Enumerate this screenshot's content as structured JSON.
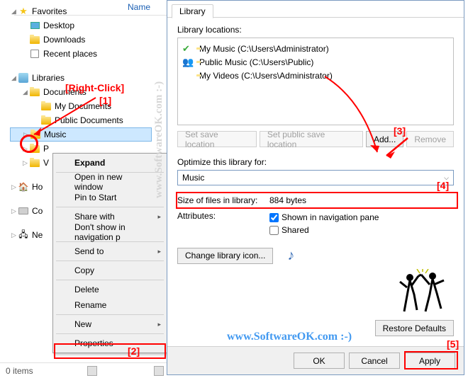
{
  "explorer": {
    "column_name": "Name",
    "favorites": "Favorites",
    "desktop": "Desktop",
    "downloads": "Downloads",
    "recent": "Recent places",
    "libraries": "Libraries",
    "documents": "Documents",
    "my_documents": "My Documents",
    "public_documents": "Public Documents",
    "music": "Music",
    "p": "P",
    "v": "V",
    "ho": "Ho",
    "co": "Co",
    "ne": "Ne",
    "status": "0 items"
  },
  "context_menu": {
    "expand": "Expand",
    "open_new": "Open in new window",
    "pin": "Pin to Start",
    "share": "Share with",
    "dont_show": "Don't show in navigation p",
    "send_to": "Send to",
    "copy": "Copy",
    "delete": "Delete",
    "rename": "Rename",
    "new": "New",
    "properties": "Properties"
  },
  "dialog": {
    "tab": "Library",
    "locations_label": "Library locations:",
    "loc1": "My Music (C:\\Users\\Administrator)",
    "loc2": "Public Music (C:\\Users\\Public)",
    "loc3": "My Videos (C:\\Users\\Administrator)",
    "btn_set_save": "Set save location",
    "btn_set_public": "Set public save location",
    "btn_add": "Add...",
    "btn_remove": "Remove",
    "optimize_label": "Optimize this library for:",
    "optimize_value": "Music",
    "size_label": "Size of files in library:",
    "size_value": "884 bytes",
    "attr_label": "Attributes:",
    "attr_shown": "Shown in navigation pane",
    "attr_shared": "Shared",
    "change_icon": "Change library icon...",
    "restore": "Restore Defaults",
    "ok": "OK",
    "cancel": "Cancel",
    "apply": "Apply"
  },
  "annotations": {
    "right_click": "[Right-Click]",
    "n1": "[1]",
    "n2": "[2]",
    "n3": "[3]",
    "n4": "[4]",
    "n5": "[5]",
    "watermark": "www.SoftwareOK.com :-)"
  }
}
